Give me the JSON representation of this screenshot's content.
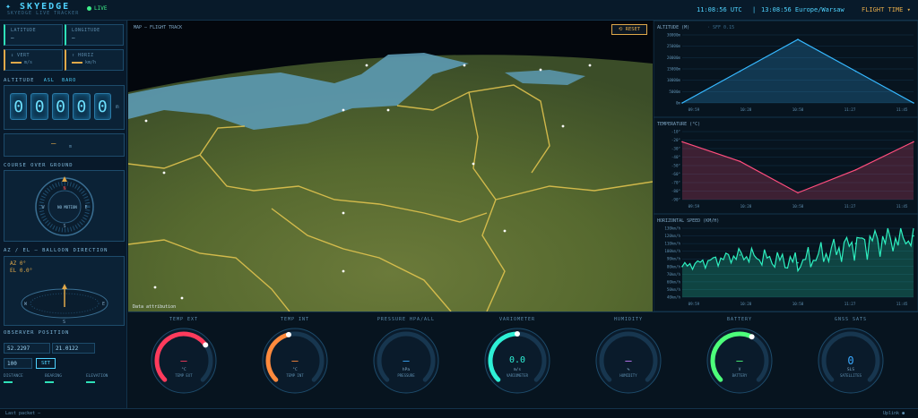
{
  "header": {
    "logo": "✦ SKYEDGE",
    "subtitle": "SKYEDGE LIVE TRACKER",
    "live": "LIVE",
    "utc": "11:08:56 UTC",
    "sep": "|",
    "local": "13:08:56 Europe/Warsaw",
    "flight_time": "FLIGHT TIME ▾"
  },
  "left": {
    "latitude_label": "LATITUDE",
    "latitude_value": "—",
    "longitude_label": "LONGITUDE",
    "longitude_value": "—",
    "vspeed_label": "↕ VERT",
    "vspeed_unit": "m/s",
    "hspeed_label": "↑ HORIZ",
    "hspeed_unit": "km/h",
    "altitude_title": "ALTITUDE",
    "alt_badge1": "ASL",
    "alt_badge2": "BARO",
    "digits": [
      "0",
      "0",
      "0",
      "0",
      "0"
    ],
    "alt_unit": "m",
    "alt_sub": "—",
    "alt_sub_unit": "m",
    "course_title": "COURSE OVER GROUND",
    "course_value": "NO MOTION",
    "azel_title": "AZ / EL — BALLOON DIRECTION",
    "az": "AZ 0°",
    "el": "EL 0.0°",
    "observer_title": "OBSERVER POSITION",
    "obs_lat": "52.2297",
    "obs_lon": "21.0122",
    "obs_alt": "100",
    "set_button": "SET",
    "distance": "DISTANCE",
    "bearing": "BEARING",
    "elevation": "ELEVATION",
    "compass_n": "N",
    "compass_w": "W",
    "compass_e": "E",
    "compass_s": "S"
  },
  "map": {
    "title": "MAP — FLIGHT TRACK",
    "reset": "⟲ RESET",
    "attribution": "Data attribution"
  },
  "charts": {
    "altitude": {
      "title": "ALTITUDE (M)",
      "sub": "· SFF 0.15",
      "ticks": [
        "30000m",
        "25000m",
        "20000m",
        "15000m",
        "10000m",
        "5000m",
        "0m"
      ],
      "xticks": [
        "09:59",
        "10:28",
        "10:58",
        "11:27",
        "11:45"
      ]
    },
    "temperature": {
      "title": "TEMPERATURE (°C)",
      "ticks": [
        "-10°",
        "-20°",
        "-30°",
        "-40°",
        "-50°",
        "-60°",
        "-70°",
        "-80°",
        "-90°"
      ],
      "xticks": [
        "09:59",
        "10:28",
        "10:58",
        "11:27",
        "11:45"
      ]
    },
    "speed": {
      "title": "HORIZONTAL SPEED (KM/H)",
      "ticks": [
        "130km/h",
        "120km/h",
        "110km/h",
        "100km/h",
        "90km/h",
        "80km/h",
        "70km/h",
        "60km/h",
        "50km/h",
        "40km/h"
      ],
      "xticks": [
        "09:59",
        "10:28",
        "10:58",
        "11:27",
        "11:45"
      ]
    }
  },
  "chart_data": [
    {
      "type": "area",
      "title": "ALTITUDE (M)",
      "x": [
        "09:59",
        "10:28",
        "10:58",
        "11:27",
        "11:45"
      ],
      "values": [
        0,
        14000,
        28000,
        14000,
        0
      ],
      "ylim": [
        0,
        30000
      ]
    },
    {
      "type": "area",
      "title": "TEMPERATURE (°C)",
      "x": [
        "09:59",
        "10:28",
        "10:58",
        "11:27",
        "11:45"
      ],
      "values": [
        -22,
        -45,
        -82,
        -55,
        -22
      ],
      "ylim": [
        -90,
        -10
      ]
    },
    {
      "type": "area",
      "title": "HORIZONTAL SPEED (KM/H)",
      "x": [
        "09:59",
        "10:28",
        "10:58",
        "11:27",
        "11:45"
      ],
      "values": [
        80,
        95,
        85,
        110,
        120
      ],
      "ylim": [
        40,
        130
      ]
    }
  ],
  "gauges": [
    {
      "title": "TEMP EXT",
      "value": "—",
      "unit": "°C",
      "name": "TEMP EXT",
      "color": "#ff3b5c",
      "fill": 0.7
    },
    {
      "title": "TEMP INT",
      "value": "—",
      "unit": "°C",
      "name": "TEMP INT",
      "color": "#ff8a3d",
      "fill": 0.45
    },
    {
      "title": "PRESSURE HPA/ALL",
      "value": "—",
      "unit": "hPa",
      "name": "PRESSURE",
      "color": "#3aa9ff",
      "fill": 0.0
    },
    {
      "title": "VARIOMETER",
      "value": "0.0",
      "unit": "m/s",
      "name": "VARIOMETER",
      "color": "#2ef0d6",
      "fill": 0.5
    },
    {
      "title": "HUMIDITY",
      "value": "—",
      "unit": "%",
      "name": "HUMIDITY",
      "color": "#c77dff",
      "fill": 0.0
    },
    {
      "title": "BATTERY",
      "value": "—",
      "unit": "V",
      "name": "BATTERY",
      "color": "#4dff7a",
      "fill": 0.6
    },
    {
      "title": "GNSS SATS",
      "value": "0",
      "unit": "SLS",
      "name": "SATELLITES",
      "color": "#3aa9ff",
      "fill": 0.0
    }
  ],
  "footer": {
    "last_packet": "Last packet —",
    "uplink": "Uplink ●"
  }
}
